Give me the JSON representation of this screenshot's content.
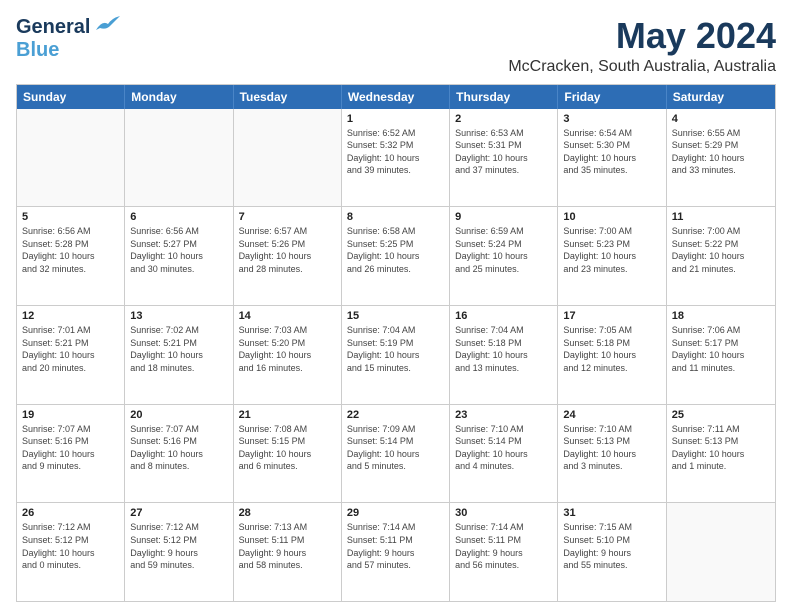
{
  "logo": {
    "line1": "General",
    "line2": "Blue"
  },
  "title": "May 2024",
  "subtitle": "McCracken, South Australia, Australia",
  "headers": [
    "Sunday",
    "Monday",
    "Tuesday",
    "Wednesday",
    "Thursday",
    "Friday",
    "Saturday"
  ],
  "rows": [
    [
      {
        "day": "",
        "info": ""
      },
      {
        "day": "",
        "info": ""
      },
      {
        "day": "",
        "info": ""
      },
      {
        "day": "1",
        "info": "Sunrise: 6:52 AM\nSunset: 5:32 PM\nDaylight: 10 hours\nand 39 minutes."
      },
      {
        "day": "2",
        "info": "Sunrise: 6:53 AM\nSunset: 5:31 PM\nDaylight: 10 hours\nand 37 minutes."
      },
      {
        "day": "3",
        "info": "Sunrise: 6:54 AM\nSunset: 5:30 PM\nDaylight: 10 hours\nand 35 minutes."
      },
      {
        "day": "4",
        "info": "Sunrise: 6:55 AM\nSunset: 5:29 PM\nDaylight: 10 hours\nand 33 minutes."
      }
    ],
    [
      {
        "day": "5",
        "info": "Sunrise: 6:56 AM\nSunset: 5:28 PM\nDaylight: 10 hours\nand 32 minutes."
      },
      {
        "day": "6",
        "info": "Sunrise: 6:56 AM\nSunset: 5:27 PM\nDaylight: 10 hours\nand 30 minutes."
      },
      {
        "day": "7",
        "info": "Sunrise: 6:57 AM\nSunset: 5:26 PM\nDaylight: 10 hours\nand 28 minutes."
      },
      {
        "day": "8",
        "info": "Sunrise: 6:58 AM\nSunset: 5:25 PM\nDaylight: 10 hours\nand 26 minutes."
      },
      {
        "day": "9",
        "info": "Sunrise: 6:59 AM\nSunset: 5:24 PM\nDaylight: 10 hours\nand 25 minutes."
      },
      {
        "day": "10",
        "info": "Sunrise: 7:00 AM\nSunset: 5:23 PM\nDaylight: 10 hours\nand 23 minutes."
      },
      {
        "day": "11",
        "info": "Sunrise: 7:00 AM\nSunset: 5:22 PM\nDaylight: 10 hours\nand 21 minutes."
      }
    ],
    [
      {
        "day": "12",
        "info": "Sunrise: 7:01 AM\nSunset: 5:21 PM\nDaylight: 10 hours\nand 20 minutes."
      },
      {
        "day": "13",
        "info": "Sunrise: 7:02 AM\nSunset: 5:21 PM\nDaylight: 10 hours\nand 18 minutes."
      },
      {
        "day": "14",
        "info": "Sunrise: 7:03 AM\nSunset: 5:20 PM\nDaylight: 10 hours\nand 16 minutes."
      },
      {
        "day": "15",
        "info": "Sunrise: 7:04 AM\nSunset: 5:19 PM\nDaylight: 10 hours\nand 15 minutes."
      },
      {
        "day": "16",
        "info": "Sunrise: 7:04 AM\nSunset: 5:18 PM\nDaylight: 10 hours\nand 13 minutes."
      },
      {
        "day": "17",
        "info": "Sunrise: 7:05 AM\nSunset: 5:18 PM\nDaylight: 10 hours\nand 12 minutes."
      },
      {
        "day": "18",
        "info": "Sunrise: 7:06 AM\nSunset: 5:17 PM\nDaylight: 10 hours\nand 11 minutes."
      }
    ],
    [
      {
        "day": "19",
        "info": "Sunrise: 7:07 AM\nSunset: 5:16 PM\nDaylight: 10 hours\nand 9 minutes."
      },
      {
        "day": "20",
        "info": "Sunrise: 7:07 AM\nSunset: 5:16 PM\nDaylight: 10 hours\nand 8 minutes."
      },
      {
        "day": "21",
        "info": "Sunrise: 7:08 AM\nSunset: 5:15 PM\nDaylight: 10 hours\nand 6 minutes."
      },
      {
        "day": "22",
        "info": "Sunrise: 7:09 AM\nSunset: 5:14 PM\nDaylight: 10 hours\nand 5 minutes."
      },
      {
        "day": "23",
        "info": "Sunrise: 7:10 AM\nSunset: 5:14 PM\nDaylight: 10 hours\nand 4 minutes."
      },
      {
        "day": "24",
        "info": "Sunrise: 7:10 AM\nSunset: 5:13 PM\nDaylight: 10 hours\nand 3 minutes."
      },
      {
        "day": "25",
        "info": "Sunrise: 7:11 AM\nSunset: 5:13 PM\nDaylight: 10 hours\nand 1 minute."
      }
    ],
    [
      {
        "day": "26",
        "info": "Sunrise: 7:12 AM\nSunset: 5:12 PM\nDaylight: 10 hours\nand 0 minutes."
      },
      {
        "day": "27",
        "info": "Sunrise: 7:12 AM\nSunset: 5:12 PM\nDaylight: 9 hours\nand 59 minutes."
      },
      {
        "day": "28",
        "info": "Sunrise: 7:13 AM\nSunset: 5:11 PM\nDaylight: 9 hours\nand 58 minutes."
      },
      {
        "day": "29",
        "info": "Sunrise: 7:14 AM\nSunset: 5:11 PM\nDaylight: 9 hours\nand 57 minutes."
      },
      {
        "day": "30",
        "info": "Sunrise: 7:14 AM\nSunset: 5:11 PM\nDaylight: 9 hours\nand 56 minutes."
      },
      {
        "day": "31",
        "info": "Sunrise: 7:15 AM\nSunset: 5:10 PM\nDaylight: 9 hours\nand 55 minutes."
      },
      {
        "day": "",
        "info": ""
      }
    ]
  ]
}
